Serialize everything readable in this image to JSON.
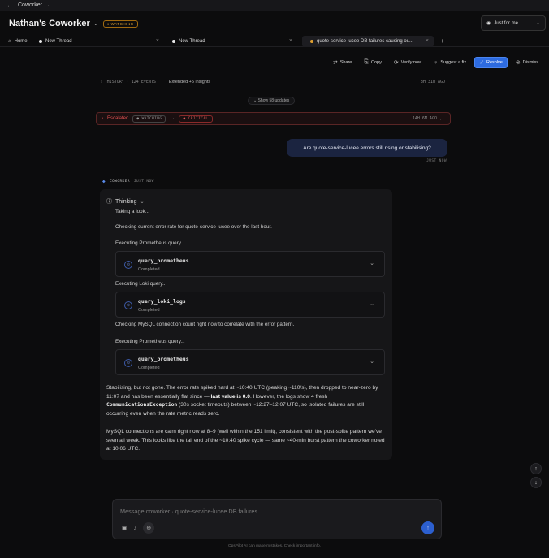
{
  "topbar": {
    "back_icon": "arrow-left-icon",
    "app_name": "Coworker"
  },
  "header": {
    "title": "Nathan's Coworker",
    "status_badge": "WATCHING",
    "filter": "Just for me"
  },
  "tabs": [
    {
      "label": "Home"
    },
    {
      "label": "New Thread"
    },
    {
      "label": "New Thread"
    },
    {
      "label": "quote-service-lucee DB failures causing ou..."
    }
  ],
  "actions": {
    "share": "Share",
    "copy": "Copy",
    "verify": "Verify now",
    "suggest": "Suggest a fix",
    "resolve": "Resolve",
    "dismiss": "Dismiss"
  },
  "history": {
    "label": "HISTORY · 124 EVENTS",
    "extended": "Extended +5 insights",
    "time": "3H 31M AGO"
  },
  "show_updates": "Show 58 updates",
  "escalation": {
    "label": "Escalated",
    "from": "WATCHING",
    "arrow": "→",
    "to": "CRITICAL",
    "time": "14H 6M AGO"
  },
  "user_message": {
    "text": "Are quote-service-lucee errors still rising or stabilising?",
    "time": "JUST NOW"
  },
  "assistant": {
    "name": "COWORKER",
    "time": "JUST NOW",
    "thinking_label": "Thinking",
    "steps": {
      "s1": "Taking a look...",
      "s2": "Checking current error rate for quote-service-lucee over the last hour.",
      "s3": "Executing Prometheus query...",
      "s4": "Executing Loki query...",
      "s5": "Checking MySQL connection count right now to correlate with the error pattern.",
      "s6": "Executing Prometheus query..."
    },
    "tools": [
      {
        "name": "query_prometheus",
        "status": "Completed"
      },
      {
        "name": "query_loki_logs",
        "status": "Completed"
      },
      {
        "name": "query_prometheus",
        "status": "Completed"
      }
    ],
    "answer": {
      "p1a": "Stabilising, but not gone. The error rate spiked hard at ~10:40 UTC (peaking ~110/s), then dropped to near-zero by 11:07 and has been essentially flat since — ",
      "p1b": "last value is 0.0",
      "p1c": ". However, the logs show 4 fresh ",
      "p1d": "CommunicationsException",
      "p1e": " (30s socket timeouts) between ~12:27–12:07 UTC, so isolated failures are still occurring even when the rate metric reads zero.",
      "p2": "MySQL connections are calm right now at 8–9 (well within the 151 limit), consistent with the post-spike pattern we've seen all week. This looks like the tail end of the ~10:40 spike cycle — same ~40-min burst pattern the coworker noted at 10:06 UTC."
    }
  },
  "composer": {
    "placeholder": "Message coworker · quote-service-lucee DB failures..."
  },
  "disclaimer": "OpsPilot AI can make mistakes. Check important info.",
  "colors": {
    "accent": "#2d6be0",
    "critical": "#e05050",
    "watching": "#e0a030"
  }
}
